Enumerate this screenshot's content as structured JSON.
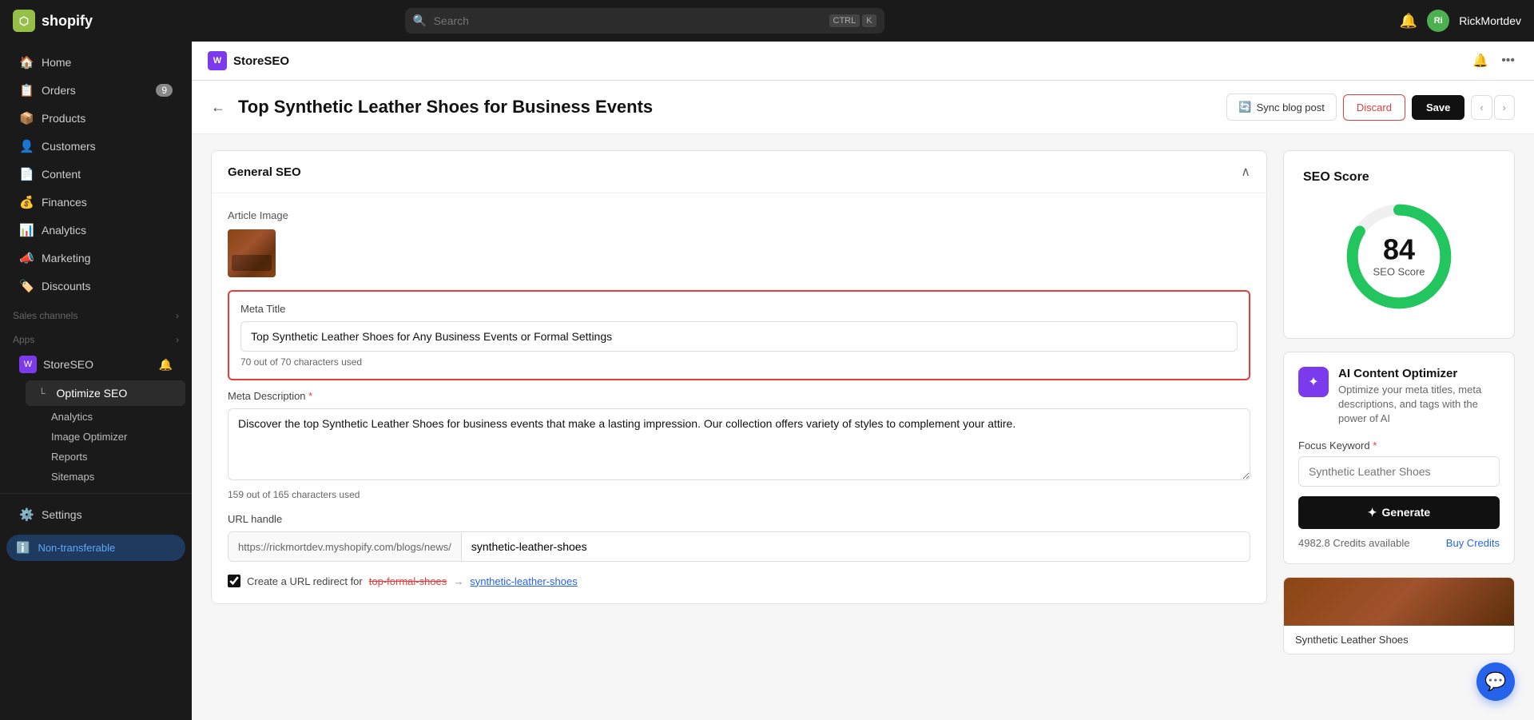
{
  "topbar": {
    "logo_text": "shopify",
    "search_placeholder": "Search",
    "search_shortcut_1": "CTRL",
    "search_shortcut_2": "K",
    "username": "RickMortdev",
    "avatar_initials": "Ri"
  },
  "sidebar": {
    "items": [
      {
        "id": "home",
        "label": "Home",
        "icon": "🏠",
        "badge": null
      },
      {
        "id": "orders",
        "label": "Orders",
        "icon": "📋",
        "badge": "9"
      },
      {
        "id": "products",
        "label": "Products",
        "icon": "📦",
        "badge": null
      },
      {
        "id": "customers",
        "label": "Customers",
        "icon": "👤",
        "badge": null
      },
      {
        "id": "content",
        "label": "Content",
        "icon": "📄",
        "badge": null
      },
      {
        "id": "finances",
        "label": "Finances",
        "icon": "💰",
        "badge": null
      },
      {
        "id": "analytics",
        "label": "Analytics",
        "icon": "📊",
        "badge": null
      },
      {
        "id": "marketing",
        "label": "Marketing",
        "icon": "📣",
        "badge": null
      },
      {
        "id": "discounts",
        "label": "Discounts",
        "icon": "🏷️",
        "badge": null
      }
    ],
    "sections": {
      "sales_channels": "Sales channels",
      "apps": "Apps"
    },
    "storeseo_label": "StoreSEO",
    "optimize_seo_label": "Optimize SEO",
    "sub_items": [
      "Analytics",
      "Image Optimizer",
      "Reports",
      "Sitemaps"
    ],
    "settings_label": "Settings",
    "non_transferable_label": "Non-transferable"
  },
  "app_header": {
    "title": "StoreSEO"
  },
  "page": {
    "title": "Top Synthetic Leather Shoes for Business Events",
    "sync_btn": "Sync blog post",
    "discard_btn": "Discard",
    "save_btn": "Save"
  },
  "general_seo": {
    "section_title": "General SEO",
    "article_image_label": "Article Image",
    "meta_title_label": "Meta Title",
    "meta_title_value": "Top Synthetic Leather Shoes for Any Business Events or Formal Settings",
    "meta_title_char_count": "70 out of 70 characters used",
    "meta_desc_label": "Meta Description",
    "meta_desc_required": true,
    "meta_desc_value": "Discover the top Synthetic Leather Shoes for business events that make a lasting impression. Our collection offers variety of styles to complement your attire.",
    "meta_desc_char_count": "159 out of 165 characters used",
    "url_handle_label": "URL handle",
    "url_prefix": "https://rickmortdev.myshopify.com/blogs/news/",
    "url_slug": "synthetic-leather-shoes",
    "redirect_from": "top-formal-shoes",
    "redirect_to": "synthetic-leather-shoes",
    "redirect_label": "Create a URL redirect for"
  },
  "seo_score": {
    "title": "SEO Score",
    "score": "84",
    "label": "SEO Score",
    "value": 84,
    "max": 100
  },
  "ai_optimizer": {
    "title": "AI Content Optimizer",
    "description": "Optimize your meta titles, meta descriptions, and tags with the power of AI",
    "focus_keyword_label": "Focus Keyword",
    "focus_keyword_required": true,
    "focus_keyword_placeholder": "Synthetic Leather Shoes",
    "generate_btn": "Generate",
    "credits_label": "4982.8 Credits available",
    "buy_credits_label": "Buy Credits"
  },
  "product_thumb": {
    "name": "Synthetic Leather Shoes"
  }
}
